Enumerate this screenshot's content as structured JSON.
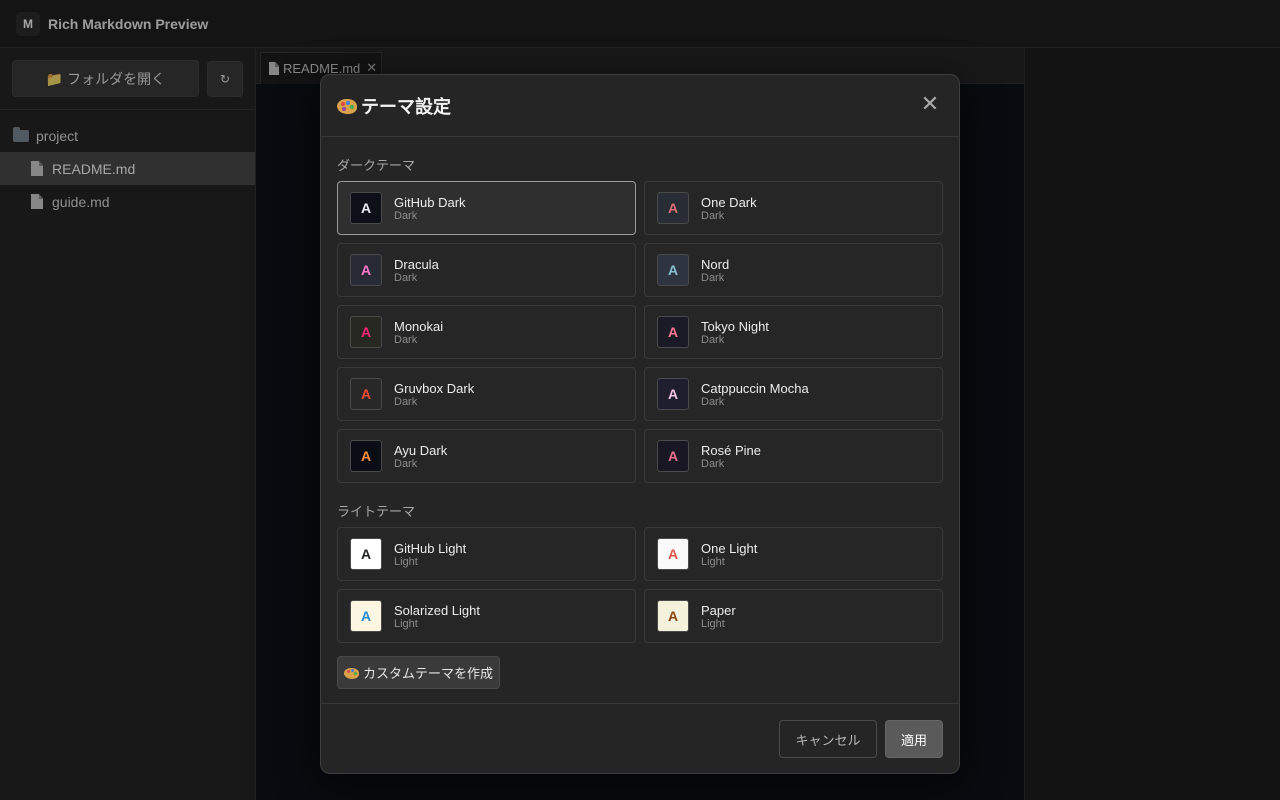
{
  "app": {
    "logo": "M",
    "title": "Rich Markdown Preview"
  },
  "sidebar": {
    "open_folder_label": "📁 フォルダを開く",
    "refresh_label": "↻",
    "tree": [
      {
        "label": "project",
        "kind": "folder",
        "icon": "folder-icon"
      },
      {
        "label": "README.md",
        "kind": "file",
        "icon": "file-icon",
        "active": true
      },
      {
        "label": "guide.md",
        "kind": "file",
        "icon": "file-icon"
      }
    ]
  },
  "tabs": [
    {
      "label": "README.md",
      "close": "✕"
    }
  ],
  "modal": {
    "title": "テーマ設定",
    "close_label": "✕",
    "dark_section_label": "ダークテーマ",
    "light_section_label": "ライトテーマ",
    "dark_themes": [
      {
        "name": "GitHub Dark",
        "kind": "Dark",
        "swatch_bg": "#0d1117",
        "swatch_fg": "#e6edf3",
        "selected": true
      },
      {
        "name": "One Dark",
        "kind": "Dark",
        "swatch_bg": "#282c34",
        "swatch_fg": "#e06c75"
      },
      {
        "name": "Dracula",
        "kind": "Dark",
        "swatch_bg": "#282a36",
        "swatch_fg": "#ff79c6"
      },
      {
        "name": "Nord",
        "kind": "Dark",
        "swatch_bg": "#2e3440",
        "swatch_fg": "#88c0d0"
      },
      {
        "name": "Monokai",
        "kind": "Dark",
        "swatch_bg": "#272822",
        "swatch_fg": "#f92672"
      },
      {
        "name": "Tokyo Night",
        "kind": "Dark",
        "swatch_bg": "#1a1b26",
        "swatch_fg": "#f7768e"
      },
      {
        "name": "Gruvbox Dark",
        "kind": "Dark",
        "swatch_bg": "#282828",
        "swatch_fg": "#fb4934"
      },
      {
        "name": "Catppuccin Mocha",
        "kind": "Dark",
        "swatch_bg": "#1e1e2e",
        "swatch_fg": "#f5c2e7"
      },
      {
        "name": "Ayu Dark",
        "kind": "Dark",
        "swatch_bg": "#0a0e14",
        "swatch_fg": "#ff8f40"
      },
      {
        "name": "Rosé Pine",
        "kind": "Dark",
        "swatch_bg": "#191724",
        "swatch_fg": "#eb6f92"
      }
    ],
    "light_themes": [
      {
        "name": "GitHub Light",
        "kind": "Light",
        "swatch_bg": "#ffffff",
        "swatch_fg": "#1f2328"
      },
      {
        "name": "One Light",
        "kind": "Light",
        "swatch_bg": "#fafafa",
        "swatch_fg": "#e45649"
      },
      {
        "name": "Solarized Light",
        "kind": "Light",
        "swatch_bg": "#fdf6e3",
        "swatch_fg": "#268bd2"
      },
      {
        "name": "Paper",
        "kind": "Light",
        "swatch_bg": "#f5f2dc",
        "swatch_fg": "#8b4513"
      }
    ],
    "custom_theme_label": "カスタムテーマを作成",
    "cancel_label": "キャンセル",
    "apply_label": "適用"
  }
}
